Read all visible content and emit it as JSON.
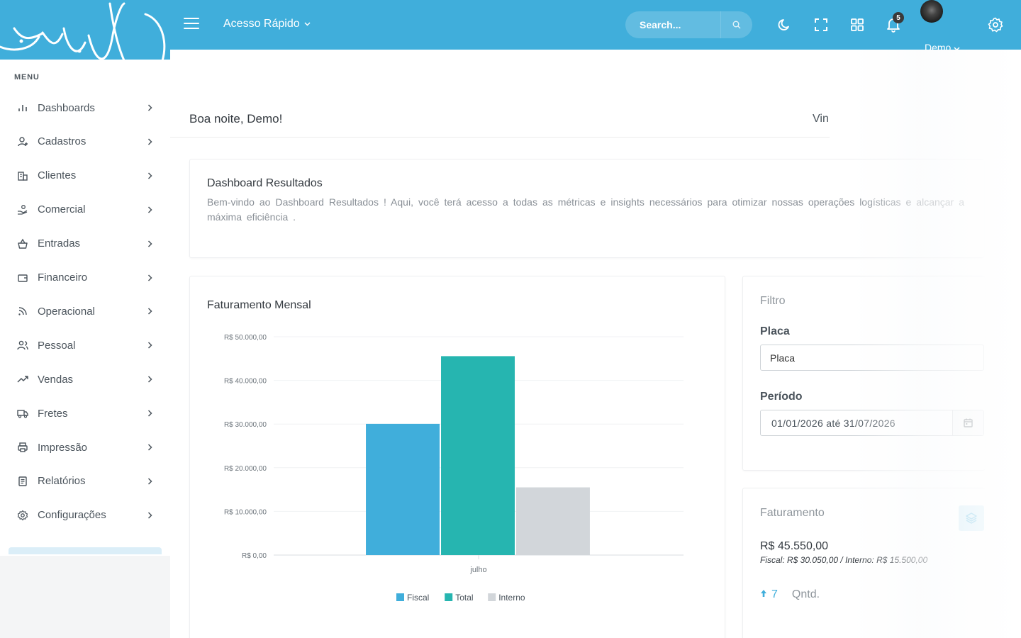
{
  "topbar": {
    "quick_access_label": "Acesso Rápido",
    "search_placeholder": "Search...",
    "notifications_count": "5",
    "user_name": "Demo",
    "brand_color": "#40aedb"
  },
  "sidebar": {
    "menu_title": "MENU",
    "items": [
      {
        "label": "Dashboards",
        "icon": "bar-chart-icon"
      },
      {
        "label": "Cadastros",
        "icon": "user-plus-icon"
      },
      {
        "label": "Clientes",
        "icon": "building-icon"
      },
      {
        "label": "Comercial",
        "icon": "hand-coins-icon"
      },
      {
        "label": "Entradas",
        "icon": "basket-icon"
      },
      {
        "label": "Financeiro",
        "icon": "wallet-icon"
      },
      {
        "label": "Operacional",
        "icon": "rss-icon"
      },
      {
        "label": "Pessoal",
        "icon": "users-icon"
      },
      {
        "label": "Vendas",
        "icon": "trending-up-icon"
      },
      {
        "label": "Fretes",
        "icon": "truck-icon"
      },
      {
        "label": "Impressão",
        "icon": "printer-icon"
      },
      {
        "label": "Relatórios",
        "icon": "report-icon"
      },
      {
        "label": "Configurações",
        "icon": "settings-icon"
      }
    ]
  },
  "main": {
    "greeting": "Boa noite, Demo!",
    "greeting_right": "Vin",
    "intro": {
      "title": "Dashboard Resultados",
      "description": "Bem-vindo ao Dashboard Resultados ! Aqui, você terá acesso a todas as métricas e insights necessários para otimizar nossas operações logísticas e alcançar a máxima eficiência ."
    },
    "chart_card": {
      "title": "Faturamento Mensal"
    },
    "filter": {
      "title": "Filtro",
      "placa_label": "Placa",
      "placa_placeholder": "Placa",
      "periodo_label": "Período",
      "periodo_value": "01/01/2026 até 31/07/2026"
    },
    "faturamento": {
      "title": "Faturamento",
      "amount": "R$ 45.550,00",
      "breakdown": "Fiscal: R$ 30.050,00 / Interno: R$ 15.500,00",
      "qtd_value": "7",
      "qtd_label": "Qntd."
    }
  },
  "chart_data": {
    "type": "bar",
    "categories": [
      "julho"
    ],
    "series": [
      {
        "name": "Fiscal",
        "values": [
          30050
        ],
        "color": "#40aedb"
      },
      {
        "name": "Total",
        "values": [
          45550
        ],
        "color": "#26b5b0"
      },
      {
        "name": "Interno",
        "values": [
          15500
        ],
        "color": "#d2d6da"
      }
    ],
    "ylim": [
      0,
      50000
    ],
    "yticks": [
      "R$ 50.000,00",
      "R$ 40.000,00",
      "R$ 30.000,00",
      "R$ 20.000,00",
      "R$ 10.000,00",
      "R$ 0,00"
    ],
    "legend": "bottom",
    "grid": true
  }
}
